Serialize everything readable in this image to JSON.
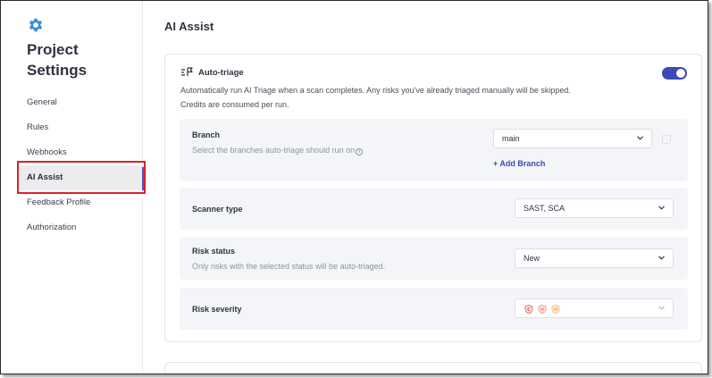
{
  "sidebar": {
    "title_line1": "Project",
    "title_line2": "Settings",
    "items": [
      {
        "label": "General"
      },
      {
        "label": "Rules"
      },
      {
        "label": "Webhooks"
      },
      {
        "label": "AI Assist"
      },
      {
        "label": "Feedback Profile"
      },
      {
        "label": "Authorization"
      }
    ],
    "active_index": 3
  },
  "main": {
    "title": "AI Assist",
    "auto_triage": {
      "title": "Auto-triage",
      "description_line1": "Automatically run AI Triage when a scan completes. Any risks you've already triaged manually will be skipped.",
      "description_line2": "Credits are consumed per run.",
      "enabled": true,
      "icon": "auto-triage-icon"
    },
    "branch": {
      "label": "Branch",
      "help": "Select the branches auto-triage should run on",
      "value": "main",
      "add_label": "+ Add Branch"
    },
    "scanner_type": {
      "label": "Scanner type",
      "value": "SAST, SCA"
    },
    "risk_status": {
      "label": "Risk status",
      "help": "Only risks with the selected status will be auto-triaged.",
      "value": "New"
    },
    "risk_severity": {
      "label": "Risk severity",
      "badges": [
        "critical-shield-icon",
        "high-shield-icon",
        "medium-shield-icon"
      ]
    }
  },
  "colors": {
    "accent": "#3b4ab5",
    "highlight": "#d8232a",
    "gear": "#3a8fd9",
    "critical": "#d9534f",
    "high": "#e8897a",
    "medium": "#efb07a"
  }
}
